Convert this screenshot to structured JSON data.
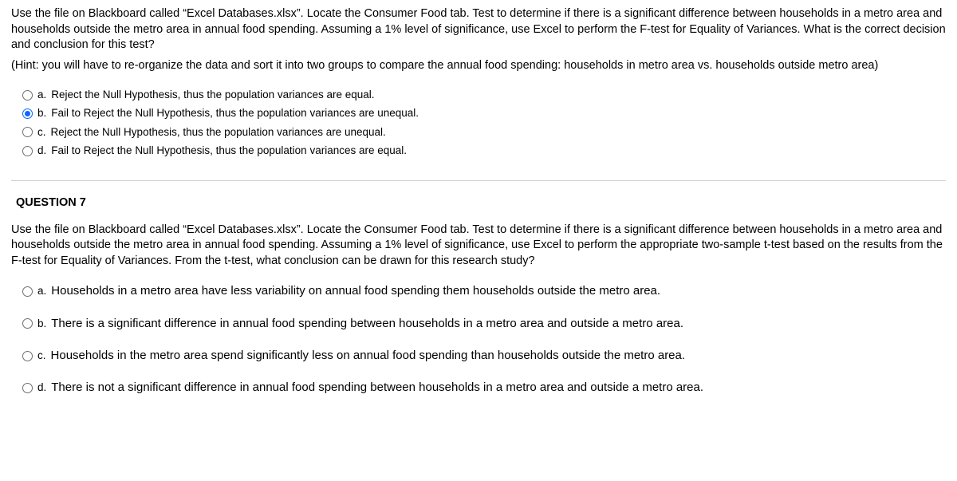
{
  "q6": {
    "prompt": "Use the file on Blackboard called “Excel Databases.xlsx”.  Locate the Consumer Food tab.  Test to determine if there is a significant difference between households in a metro area and households outside the metro area in annual food spending.  Assuming a 1% level of significance, use Excel to perform the F-test for Equality of Variances.  What is the correct decision and conclusion for this test?",
    "hint": "(Hint:  you will have to re-organize the data and sort it into two groups to compare the annual food spending:  households in metro area vs. households outside metro area)",
    "options": [
      {
        "letter": "a.",
        "text": "Reject the Null Hypothesis, thus the population variances are equal.",
        "selected": false
      },
      {
        "letter": "b.",
        "text": "Fail to Reject the Null Hypothesis, thus the population variances are unequal.",
        "selected": true
      },
      {
        "letter": "c.",
        "text": "Reject the Null Hypothesis, thus the population variances are unequal.",
        "selected": false
      },
      {
        "letter": "d.",
        "text": "Fail to Reject the Null Hypothesis, thus the population variances are equal.",
        "selected": false
      }
    ]
  },
  "q7": {
    "heading": "QUESTION 7",
    "prompt": "Use the file on Blackboard called “Excel Databases.xlsx”.  Locate the Consumer Food tab.  Test to determine if there is a significant difference between households in a metro area and households outside the metro area in annual food spending.  Assuming a 1% level of significance, use Excel to perform the appropriate two-sample t-test based on the results from the F-test for Equality of Variances.  From the t-test, what conclusion can be drawn for this research study?",
    "options": [
      {
        "letter": "a.",
        "text": "Households in a metro area have less variability on annual food spending them households outside the metro area.",
        "selected": false
      },
      {
        "letter": "b.",
        "text": "There is a significant difference in annual food spending between households in a metro area and outside a metro area.",
        "selected": false
      },
      {
        "letter": "c.",
        "text": "Households in the metro area spend significantly less on annual food spending than households outside the metro area.",
        "selected": false
      },
      {
        "letter": "d.",
        "text": "There is not a significant difference in annual food spending between households in a metro area and outside a metro area.",
        "selected": false
      }
    ]
  }
}
